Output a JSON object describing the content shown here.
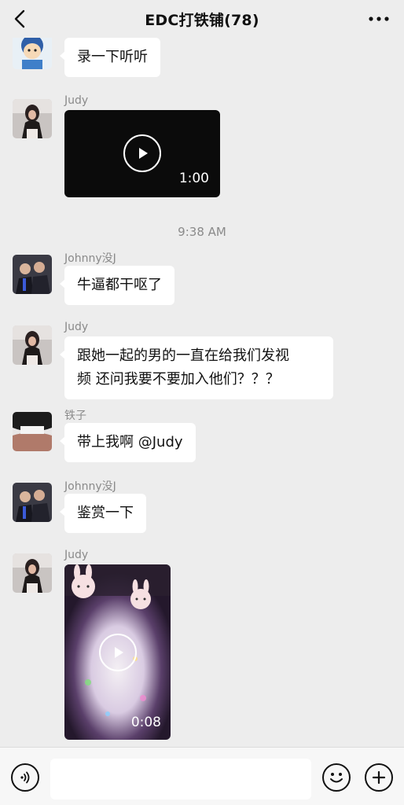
{
  "header": {
    "title": "EDC打铁铺(78)"
  },
  "messages": [
    {
      "type": "text",
      "sender": "",
      "text": "录一下听听",
      "avatar": "cartoon-avatar"
    },
    {
      "type": "video",
      "sender": "Judy",
      "duration": "1:00",
      "avatar": "judy-avatar"
    },
    {
      "type": "timestamp",
      "text": "9:38 AM"
    },
    {
      "type": "text",
      "sender": "Johnny没J",
      "text": "牛逼都干呕了",
      "avatar": "johnny-avatar"
    },
    {
      "type": "text",
      "sender": "Judy",
      "text_line1": "跟她一起的男的一直在给我们发视",
      "text_line2": "频 还问我要不要加入他们？？？",
      "avatar": "judy-avatar"
    },
    {
      "type": "text",
      "sender": "铁子",
      "text": "带上我啊 @Judy",
      "avatar": "tiezi-avatar"
    },
    {
      "type": "text",
      "sender": "Johnny没J",
      "text": "鉴赏一下",
      "avatar": "johnny-avatar"
    },
    {
      "type": "video",
      "sender": "Judy",
      "duration": "0:08",
      "avatar": "judy-avatar"
    }
  ],
  "input": {
    "placeholder": ""
  },
  "icons": {
    "back": "chevron-left-icon",
    "more": "more-dots-icon",
    "voice": "voice-icon",
    "emoji": "emoji-icon",
    "plus": "plus-icon"
  },
  "colors": {
    "background": "#ededed",
    "bubble": "#ffffff",
    "meta_text": "#8a8a8a"
  }
}
